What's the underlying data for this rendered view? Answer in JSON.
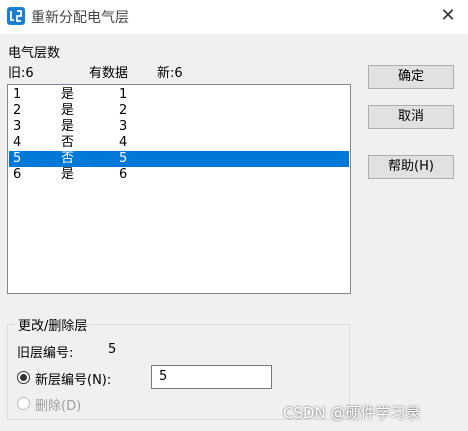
{
  "window": {
    "title": "重新分配电气层",
    "icon": "app-icon",
    "close_glyph": "✕"
  },
  "header": {
    "section_label": "电气层数",
    "col_old": "旧:6",
    "col_has_data": "有数据",
    "col_new": "新:6"
  },
  "layers": [
    {
      "old": "1",
      "has_data": "是",
      "new": "1",
      "selected": false
    },
    {
      "old": "2",
      "has_data": "是",
      "new": "2",
      "selected": false
    },
    {
      "old": "3",
      "has_data": "是",
      "new": "3",
      "selected": false
    },
    {
      "old": "4",
      "has_data": "否",
      "new": "4",
      "selected": false
    },
    {
      "old": "5",
      "has_data": "否",
      "new": "5",
      "selected": true
    },
    {
      "old": "6",
      "has_data": "是",
      "new": "6",
      "selected": false
    }
  ],
  "buttons": {
    "ok": "确定",
    "cancel": "取消",
    "help": "帮助(H)"
  },
  "modify_group": {
    "title": "更改/删除层",
    "old_number_label": "旧层编号:",
    "old_number_value": "5",
    "new_number_radio_label": "新层编号(N):",
    "new_number_value": "5",
    "delete_radio_label": "删除(D)",
    "selected_option": "new_number"
  },
  "watermark": "CSDN @硬件学习录",
  "colors": {
    "selection": "#0078d7",
    "app_icon": "#1a7fd4"
  }
}
